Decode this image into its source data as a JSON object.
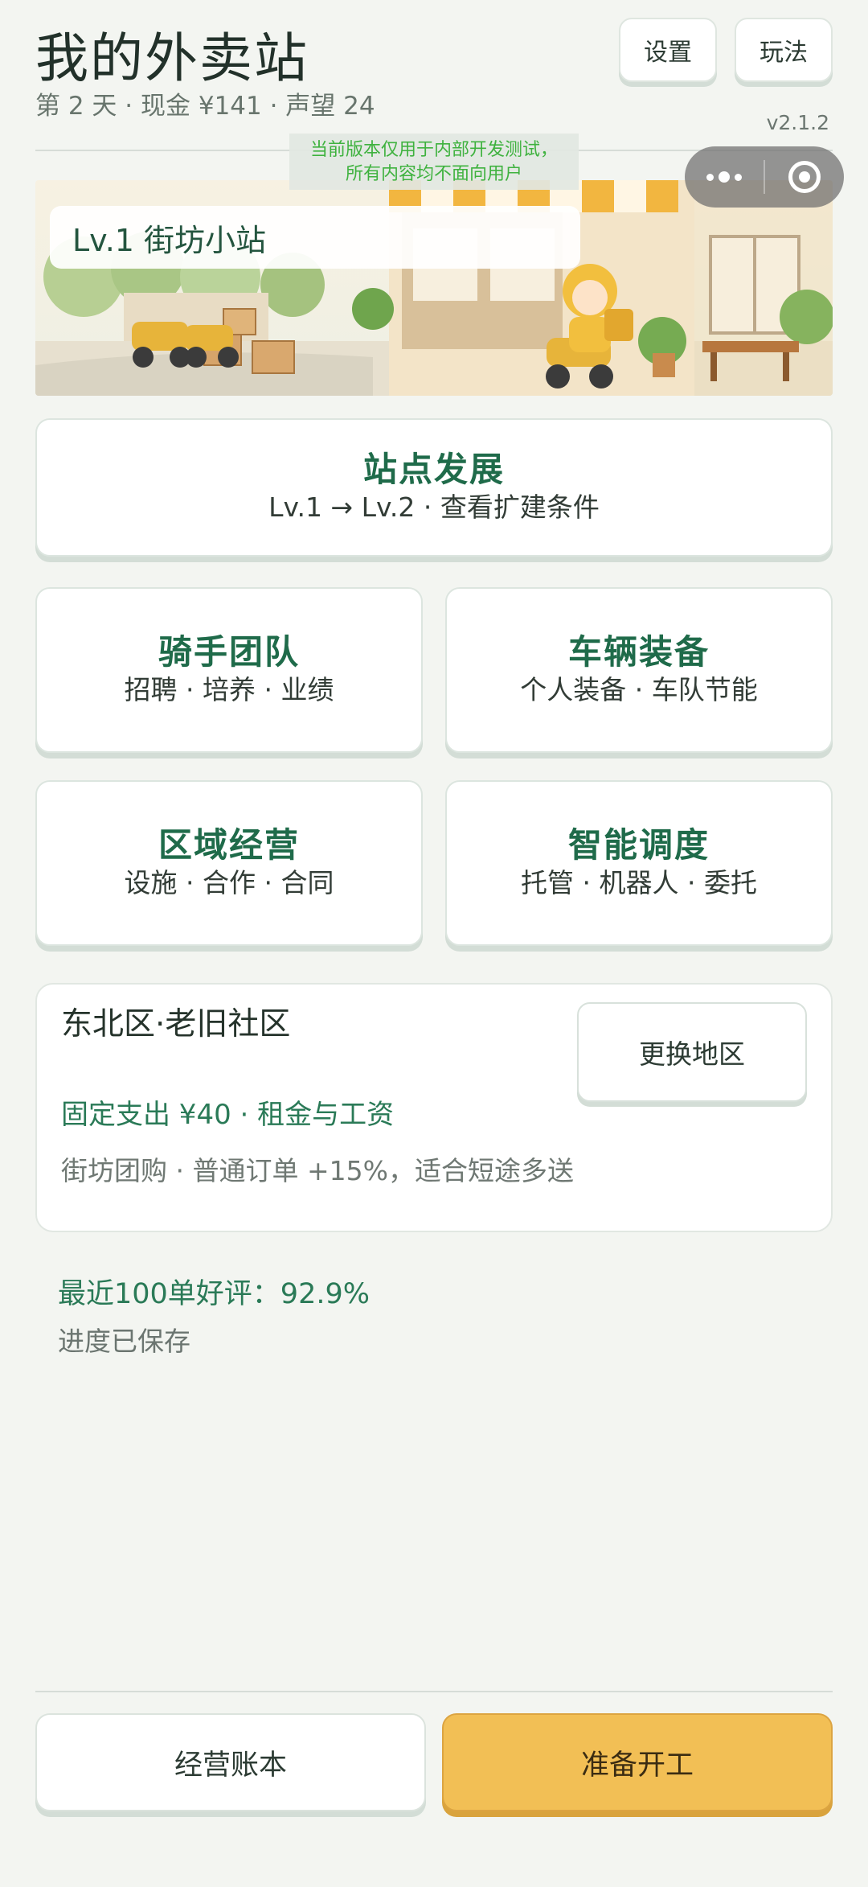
{
  "header": {
    "title": "我的外卖站",
    "subtitle": "第 2 天 · 现金 ¥141 · 声望 24",
    "settings_label": "设置",
    "howto_label": "玩法",
    "version": "v2.1.2"
  },
  "dev_notice": {
    "line1": "当前版本仅用于内部开发测试，",
    "line2": "所有内容均不面向用户"
  },
  "banner": {
    "level_label": "Lv.1 街坊小站"
  },
  "cards": {
    "development": {
      "title": "站点发展",
      "subtitle": "Lv.1 → Lv.2 · 查看扩建条件"
    },
    "riders": {
      "title": "骑手团队",
      "subtitle": "招聘 · 培养 · 业绩"
    },
    "vehicles": {
      "title": "车辆装备",
      "subtitle": "个人装备 · 车队节能"
    },
    "region": {
      "title": "区域经营",
      "subtitle": "设施 · 合作 · 合同"
    },
    "dispatch": {
      "title": "智能调度",
      "subtitle": "托管 · 机器人 · 委托"
    }
  },
  "area": {
    "name": "东北区·老旧社区",
    "change_label": "更换地区",
    "fixed_cost": "固定支出 ¥40 · 租金与工资",
    "description": "街坊团购 · 普通订单 +15%，适合短途多送"
  },
  "stats": {
    "rating": "最近100单好评：92.9%",
    "saved": "进度已保存"
  },
  "bottom": {
    "ledger_label": "经营账本",
    "start_label": "准备开工"
  },
  "colors": {
    "accent_green": "#1f6b4a",
    "start_button": "#f2bf55",
    "background": "#f3f5f1"
  }
}
